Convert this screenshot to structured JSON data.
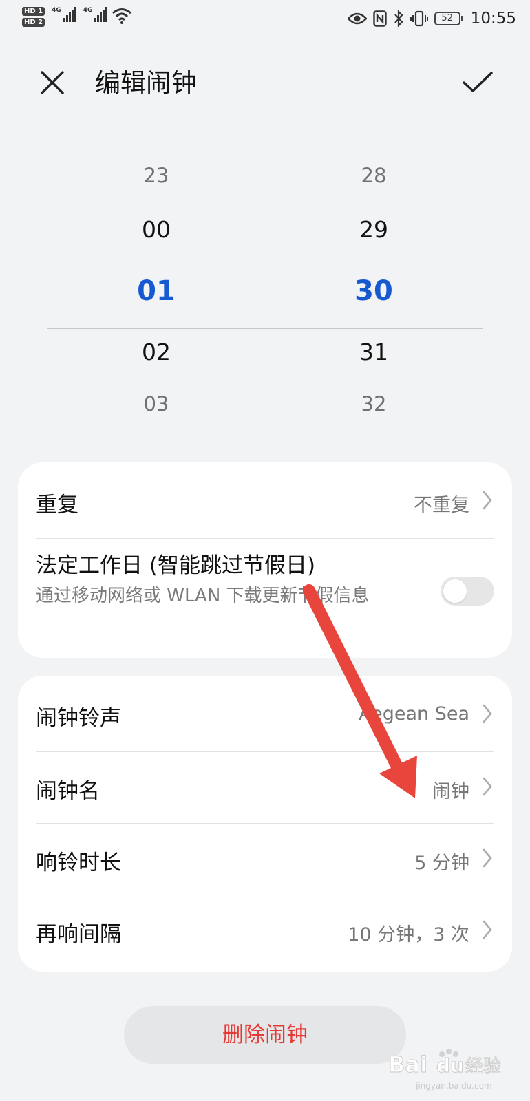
{
  "status_bar": {
    "hd1": "HD 1",
    "hd2": "HD 2",
    "net1": "4G",
    "net2": "4G",
    "battery": "52",
    "time": "10:55"
  },
  "header": {
    "title": "编辑闹钟",
    "close_icon": "close-icon",
    "confirm_icon": "check-icon"
  },
  "picker": {
    "hours": [
      "23",
      "00",
      "01",
      "02",
      "03"
    ],
    "minutes": [
      "28",
      "29",
      "30",
      "31",
      "32"
    ],
    "selected_color": "#1659d1"
  },
  "repeat_card": {
    "repeat": {
      "label": "重复",
      "value": "不重复"
    },
    "workday": {
      "label": "法定工作日 (智能跳过节假日)",
      "sub": "通过移动网络或 WLAN 下载更新节假信息",
      "toggle_on": false
    }
  },
  "settings_card": {
    "ringtone": {
      "label": "闹钟铃声",
      "value": "Aegean Sea"
    },
    "name": {
      "label": "闹钟名",
      "value": "闹钟"
    },
    "duration": {
      "label": "响铃时长",
      "value": "5 分钟"
    },
    "snooze": {
      "label": "再响间隔",
      "value": "10 分钟，3 次"
    }
  },
  "delete_button": {
    "label": "删除闹钟",
    "color": "#e53935"
  },
  "watermark": {
    "brand": "Bai",
    "paw": "du",
    "suffix": "经验",
    "domain": "jingyan.baidu.com"
  },
  "annotation": {
    "arrow_color": "#e8453c"
  }
}
